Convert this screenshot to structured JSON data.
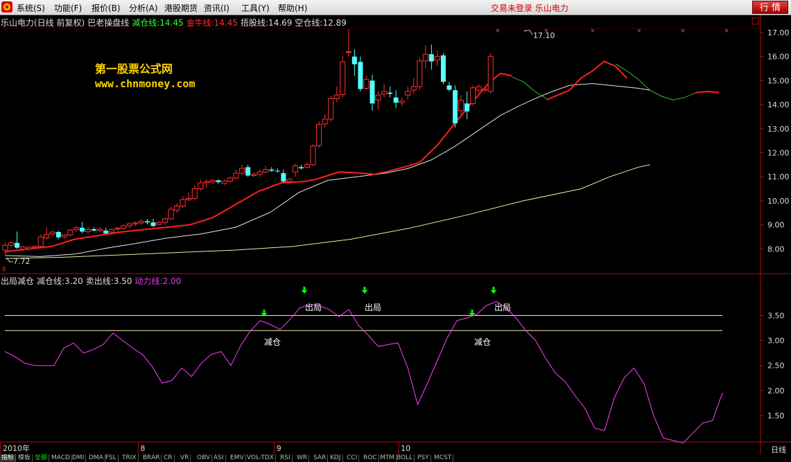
{
  "menubar": {
    "items": [
      {
        "label": "系统(S)",
        "x": 24
      },
      {
        "label": "功能(F)",
        "x": 78
      },
      {
        "label": "报价(B)",
        "x": 132
      },
      {
        "label": "分析(A)",
        "x": 186
      },
      {
        "label": "港股期货",
        "x": 237
      },
      {
        "label": "资讯(I)",
        "x": 294
      },
      {
        "label": "工具(Y)",
        "x": 348
      },
      {
        "label": "帮助(H)",
        "x": 401
      }
    ],
    "login_status": "交易未登录  乐山电力",
    "market_button": "行 情"
  },
  "main_legend": {
    "stock": "乐山电力(日线 前复权)",
    "indicator": "巴老操盘线",
    "jiancang": "减仓线:14.45",
    "jinniu": "金牛线:14.45",
    "zhuogu": "捂股线:14.69",
    "kongcang": "空仓线:12.89"
  },
  "sub_legend": {
    "name": "出局减仓",
    "jiancang": "减仓线:3.20",
    "maichu": "卖出线:3.50",
    "dongli": "动力线:2.00"
  },
  "watermark": {
    "title": "第一股票公式网",
    "url": "www.chnmoney.com"
  },
  "annotations": {
    "high": "17.10",
    "low": "7.72",
    "chuju": "出局",
    "jiancang": "减仓"
  },
  "price_axis": [
    "17.00",
    "16.00",
    "15.00",
    "14.00",
    "13.00",
    "12.00",
    "11.00",
    "10.00",
    "9.00",
    "8.00"
  ],
  "osc_axis": [
    "3.50",
    "3.00",
    "2.50",
    "2.00",
    "1.50"
  ],
  "date_axis": [
    {
      "label": "2010年",
      "idx": 0
    },
    {
      "label": "8",
      "idx": 22
    },
    {
      "label": "9",
      "idx": 45
    },
    {
      "label": "10",
      "idx": 66
    }
  ],
  "period_label": "日线",
  "tabs": [
    "指标",
    "模板",
    "全部",
    "MACD",
    "DMI",
    "DMA",
    "FSL",
    "TRIX",
    "BRAR",
    "CR",
    "VR",
    "OBV",
    "ASI",
    "EMV",
    "VOL-TDX",
    "RSI",
    "WR",
    "SAR",
    "KDJ",
    "CCI",
    "ROC",
    "MTM",
    "BOLL",
    "PSY",
    "MCST"
  ],
  "colors": {
    "up": "#ff3232",
    "down": "#54ffff",
    "ma_red": "#ff2020",
    "ma_white": "#e8e8e8",
    "ma_yellow": "#f0f0a0",
    "osc": "#ff40ff",
    "level": "#f0f0b0",
    "arrow": "#00ff00"
  },
  "chart_data": {
    "type": "candlestick",
    "ylim": [
      7.5,
      17.5
    ],
    "candles": [
      [
        7.95,
        8.25,
        7.72,
        8.15
      ],
      [
        8.15,
        8.3,
        8.05,
        8.25
      ],
      [
        8.25,
        8.72,
        8.0,
        8.05
      ],
      [
        7.98,
        8.13,
        7.9,
        8.08
      ],
      [
        8.0,
        8.1,
        7.92,
        8.07
      ],
      [
        8.05,
        8.15,
        8.0,
        8.1
      ],
      [
        8.1,
        8.6,
        8.05,
        8.5
      ],
      [
        8.45,
        8.9,
        8.4,
        8.6
      ],
      [
        8.62,
        8.75,
        8.55,
        8.7
      ],
      [
        8.7,
        8.75,
        8.4,
        8.48
      ],
      [
        8.5,
        8.62,
        8.42,
        8.58
      ],
      [
        8.58,
        8.82,
        8.52,
        8.78
      ],
      [
        8.8,
        8.95,
        8.7,
        8.88
      ],
      [
        8.88,
        9.12,
        8.65,
        8.72
      ],
      [
        8.72,
        8.9,
        8.62,
        8.8
      ],
      [
        8.82,
        8.9,
        8.72,
        8.76
      ],
      [
        8.76,
        8.9,
        8.7,
        8.82
      ],
      [
        8.76,
        8.88,
        8.68,
        8.64
      ],
      [
        8.7,
        8.85,
        8.6,
        8.8
      ],
      [
        8.82,
        8.92,
        8.72,
        8.86
      ],
      [
        8.85,
        9.02,
        8.8,
        8.96
      ],
      [
        8.96,
        9.1,
        8.86,
        9.04
      ],
      [
        9.04,
        9.15,
        8.95,
        9.08
      ],
      [
        9.08,
        9.25,
        9.0,
        9.15
      ],
      [
        9.15,
        9.25,
        9.02,
        9.1
      ],
      [
        9.1,
        9.25,
        8.9,
        8.95
      ],
      [
        9.02,
        9.15,
        8.98,
        9.1
      ],
      [
        9.1,
        9.3,
        9.0,
        9.25
      ],
      [
        9.25,
        9.75,
        9.2,
        9.65
      ],
      [
        9.6,
        9.9,
        9.5,
        9.78
      ],
      [
        9.78,
        10.2,
        9.7,
        10.05
      ],
      [
        10.05,
        10.35,
        9.98,
        10.1
      ],
      [
        10.1,
        10.65,
        10.05,
        10.5
      ],
      [
        10.5,
        10.9,
        10.4,
        10.75
      ],
      [
        10.75,
        10.9,
        10.55,
        10.8
      ],
      [
        10.78,
        10.9,
        10.7,
        10.85
      ],
      [
        10.85,
        10.9,
        10.7,
        10.78
      ],
      [
        10.72,
        10.9,
        10.65,
        10.82
      ],
      [
        10.82,
        11.0,
        10.75,
        10.95
      ],
      [
        10.95,
        11.3,
        10.88,
        11.15
      ],
      [
        11.15,
        11.5,
        11.05,
        11.35
      ],
      [
        11.4,
        11.5,
        11.0,
        11.05
      ],
      [
        11.05,
        11.2,
        10.98,
        11.1
      ],
      [
        11.1,
        11.3,
        11.0,
        11.2
      ],
      [
        11.2,
        11.45,
        11.15,
        11.3
      ],
      [
        11.3,
        11.4,
        11.2,
        11.25
      ],
      [
        11.25,
        11.35,
        11.18,
        11.22
      ],
      [
        11.15,
        11.3,
        10.75,
        10.8
      ],
      [
        10.8,
        10.95,
        10.7,
        10.9
      ],
      [
        11.2,
        11.55,
        11.0,
        11.45
      ],
      [
        11.4,
        11.5,
        11.3,
        11.35
      ],
      [
        11.4,
        11.6,
        11.35,
        11.5
      ],
      [
        11.5,
        12.35,
        11.45,
        12.28
      ],
      [
        12.3,
        13.3,
        12.2,
        13.18
      ],
      [
        13.2,
        13.6,
        13.05,
        13.4
      ],
      [
        13.4,
        14.35,
        13.3,
        14.25
      ],
      [
        14.25,
        14.75,
        14.1,
        14.4
      ],
      [
        14.42,
        16.02,
        14.3,
        15.78
      ],
      [
        16.18,
        17.15,
        16.0,
        16.2
      ],
      [
        16.0,
        16.3,
        15.2,
        15.68
      ],
      [
        15.78,
        16.0,
        14.55,
        14.65
      ],
      [
        14.68,
        15.2,
        14.6,
        15.05
      ],
      [
        15.0,
        15.25,
        13.75,
        14.05
      ],
      [
        14.2,
        14.55,
        13.8,
        14.4
      ],
      [
        14.45,
        14.85,
        14.3,
        14.55
      ],
      [
        14.5,
        14.75,
        14.3,
        14.45
      ],
      [
        14.3,
        14.6,
        13.85,
        14.08
      ],
      [
        14.08,
        14.3,
        13.95,
        14.15
      ],
      [
        14.4,
        14.75,
        14.2,
        14.55
      ],
      [
        14.6,
        15.1,
        14.45,
        14.75
      ],
      [
        14.75,
        15.95,
        14.6,
        15.82
      ],
      [
        15.82,
        16.45,
        15.5,
        16.1
      ],
      [
        16.1,
        16.5,
        15.45,
        15.8
      ],
      [
        15.85,
        16.25,
        15.6,
        16.0
      ],
      [
        16.05,
        16.15,
        14.85,
        14.95
      ],
      [
        14.8,
        14.95,
        14.55,
        14.62
      ],
      [
        14.6,
        14.8,
        13.05,
        13.22
      ],
      [
        13.75,
        14.38,
        13.6,
        14.18
      ],
      [
        14.05,
        14.55,
        13.4,
        13.72
      ],
      [
        14.05,
        14.8,
        13.95,
        14.7
      ],
      [
        14.6,
        14.85,
        14.5,
        14.75
      ],
      [
        14.6,
        14.72,
        14.5,
        14.65
      ],
      [
        14.55,
        16.15,
        14.45,
        16.0
      ]
    ],
    "ma_white": [
      [
        0,
        7.72
      ],
      [
        6,
        7.68
      ],
      [
        12,
        7.78
      ],
      [
        18,
        8.05
      ],
      [
        22,
        8.2
      ],
      [
        28,
        8.45
      ],
      [
        34,
        8.62
      ],
      [
        40,
        8.9
      ],
      [
        46,
        9.52
      ],
      [
        51,
        10.35
      ],
      [
        56,
        10.85
      ],
      [
        61,
        11.0
      ],
      [
        66,
        11.15
      ],
      [
        70,
        11.35
      ],
      [
        74,
        11.7
      ],
      [
        78,
        12.25
      ],
      [
        82,
        12.9
      ],
      [
        86,
        13.55
      ],
      [
        89,
        13.92
      ],
      [
        92,
        14.25
      ],
      [
        95,
        14.55
      ],
      [
        98,
        14.8
      ],
      [
        102,
        14.88
      ],
      [
        106,
        14.78
      ],
      [
        110,
        14.68
      ],
      [
        112,
        14.6
      ]
    ],
    "ma_yellow": [
      [
        0,
        7.6
      ],
      [
        10,
        7.65
      ],
      [
        20,
        7.75
      ],
      [
        30,
        7.85
      ],
      [
        40,
        7.95
      ],
      [
        50,
        8.1
      ],
      [
        60,
        8.4
      ],
      [
        70,
        8.85
      ],
      [
        80,
        9.4
      ],
      [
        90,
        10.0
      ],
      [
        100,
        10.5
      ],
      [
        105,
        11.0
      ],
      [
        110,
        11.4
      ],
      [
        112,
        11.5
      ]
    ],
    "ma_red_segments": [
      [
        [
          0,
          7.88
        ],
        [
          4,
          8.0
        ],
        [
          8,
          8.1
        ],
        [
          12,
          8.4
        ],
        [
          16,
          8.55
        ],
        [
          20,
          8.7
        ],
        [
          24,
          8.8
        ],
        [
          28,
          8.9
        ],
        [
          32,
          9.0
        ],
        [
          36,
          9.3
        ],
        [
          40,
          9.85
        ],
        [
          44,
          10.4
        ],
        [
          48,
          10.75
        ],
        [
          52,
          10.8
        ],
        [
          54,
          10.9
        ],
        [
          56,
          11.05
        ],
        [
          58,
          11.2
        ],
        [
          62,
          11.15
        ],
        [
          64,
          11.1
        ],
        [
          66,
          11.2
        ],
        [
          70,
          11.45
        ],
        [
          72,
          11.6
        ],
        [
          75,
          12.3
        ],
        [
          78,
          13.2
        ],
        [
          82,
          14.35
        ],
        [
          84,
          14.9
        ],
        [
          86,
          15.3
        ],
        [
          88,
          15.2
        ]
      ],
      [
        [
          94,
          14.2
        ],
        [
          98,
          14.6
        ],
        [
          100,
          15.1
        ],
        [
          102,
          15.4
        ],
        [
          104,
          15.8
        ],
        [
          106,
          15.6
        ],
        [
          108,
          15.1
        ]
      ],
      [
        [
          120,
          14.5
        ],
        [
          122,
          14.55
        ],
        [
          124,
          14.5
        ]
      ]
    ],
    "ma_green_segments": [
      [
        [
          88,
          15.15
        ],
        [
          90,
          14.95
        ],
        [
          92,
          14.55
        ],
        [
          94,
          14.25
        ]
      ],
      [
        [
          106,
          15.7
        ],
        [
          108,
          15.4
        ],
        [
          110,
          15.05
        ],
        [
          112,
          14.6
        ],
        [
          114,
          14.35
        ],
        [
          116,
          14.2
        ],
        [
          118,
          14.3
        ],
        [
          120,
          14.5
        ]
      ]
    ],
    "oscillator": {
      "ylim": [
        1.0,
        4.2
      ],
      "levels": {
        "maichu": 3.5,
        "jiancang": 3.2
      },
      "values": [
        2.78,
        2.68,
        2.55,
        2.5,
        2.5,
        2.5,
        2.85,
        2.95,
        2.75,
        2.82,
        2.92,
        3.15,
        3.0,
        2.85,
        2.72,
        2.48,
        2.15,
        2.2,
        2.45,
        2.28,
        2.55,
        2.72,
        2.78,
        2.5,
        2.9,
        3.2,
        3.4,
        3.32,
        3.22,
        3.42,
        3.65,
        3.72,
        3.7,
        3.62,
        3.48,
        3.62,
        3.3,
        3.1,
        2.88,
        2.92,
        2.95,
        2.45,
        1.72,
        2.15,
        2.6,
        3.05,
        3.4,
        3.45,
        3.52,
        3.7,
        3.78,
        3.65,
        3.45,
        3.2,
        3.0,
        2.65,
        2.35,
        2.18,
        1.9,
        1.65,
        1.25,
        1.2,
        1.85,
        2.25,
        2.45,
        2.15,
        1.5,
        1.05,
        1.0,
        0.95,
        1.15,
        1.35,
        1.4,
        1.95
      ]
    }
  }
}
